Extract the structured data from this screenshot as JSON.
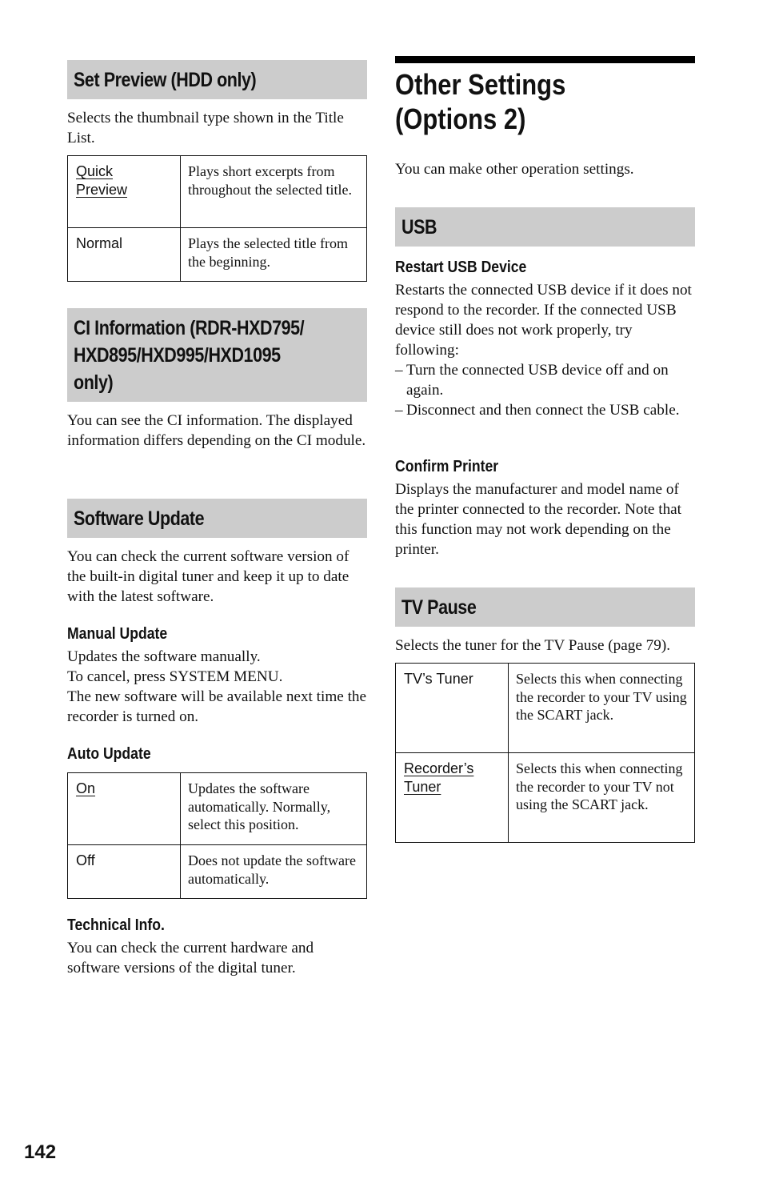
{
  "page_number": "142",
  "left_column": {
    "set_preview": {
      "heading": "Set Preview (HDD only)",
      "intro": "Selects the thumbnail type shown in the Title List.",
      "options": [
        {
          "key_line1": "Quick",
          "key_line2": "Preview",
          "default": true,
          "description": "Plays short excerpts from throughout the selected title."
        },
        {
          "key_line1": "Normal",
          "key_line2": "",
          "default": false,
          "description": "Plays the selected title from the beginning."
        }
      ]
    },
    "ci_information": {
      "heading_line1": "CI Information (RDR-HXD795/",
      "heading_line2": "HXD895/HXD995/HXD1095",
      "heading_line3": "only)",
      "body": "You can see the CI information. The displayed information differs depending on the CI module."
    },
    "software_update": {
      "heading": "Software Update",
      "intro": "You can check the current software version of the built-in digital tuner and keep it up to date with the latest software.",
      "manual_update": {
        "heading": "Manual Update",
        "line1": "Updates the software manually.",
        "line2": "To cancel, press SYSTEM MENU.",
        "line3": "The new software will be available next time the recorder is turned on."
      },
      "auto_update": {
        "heading": "Auto Update",
        "options": [
          {
            "key": "On",
            "default": true,
            "description": "Updates the software automatically. Normally, select this position."
          },
          {
            "key": "Off",
            "default": false,
            "description": "Does not update the software automatically."
          }
        ]
      },
      "technical_info": {
        "heading": "Technical Info.",
        "body": "You can check the current hardware and software versions of the digital tuner."
      }
    }
  },
  "right_column": {
    "title_line1": "Other Settings",
    "title_line2": "(Options 2)",
    "intro": "You can make other operation settings.",
    "usb": {
      "heading": "USB",
      "restart": {
        "heading": "Restart USB Device",
        "body": "Restarts the connected USB device if it does not respond to the recorder. If the connected USB device still does not work properly, try following:",
        "bullets": [
          "Turn the connected USB device off and on again.",
          "Disconnect and then connect the USB cable."
        ],
        "bullet_marker": "–"
      },
      "confirm_printer": {
        "heading": "Confirm Printer",
        "body": "Displays the manufacturer and model name of the printer connected to the recorder. Note that this function may not work depending on the printer."
      }
    },
    "tv_pause": {
      "heading": "TV Pause",
      "intro": "Selects the tuner for the TV Pause (page 79).",
      "options": [
        {
          "key_line1": "TV’s Tuner",
          "key_line2": "",
          "default": false,
          "description": "Selects this when connecting the recorder to your TV using the SCART jack."
        },
        {
          "key_line1": "Recorder’s",
          "key_line2": "Tuner",
          "default": true,
          "description": "Selects this when connecting the recorder to your TV not using the SCART jack."
        }
      ]
    }
  }
}
